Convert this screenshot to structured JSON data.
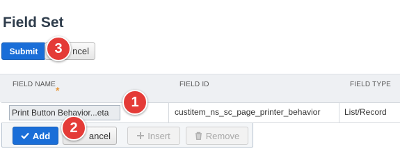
{
  "page": {
    "title": "Field Set"
  },
  "top_actions": {
    "submit_label": "Submit",
    "cancel_label": "Cancel",
    "cancel_visible": "ncel"
  },
  "table": {
    "headers": {
      "name": "FIELD NAME",
      "id": "FIELD ID",
      "type": "FIELD TYPE"
    },
    "required_marker": "*",
    "edit_row": {
      "name_value": "Print Button Behavior...eta",
      "field_id": "custitem_ns_sc_page_printer_behavior",
      "field_type": "List/Record"
    }
  },
  "row_actions": {
    "add_label": "Add",
    "cancel_label": "Cancel",
    "cancel_visible": "ancel",
    "insert_label": "Insert",
    "remove_label": "Remove"
  },
  "callouts": [
    "1",
    "2",
    "3"
  ],
  "colors": {
    "primary": "#1a6ed8",
    "callout": "#e43b37",
    "title": "#2f3d4c",
    "required": "#e8983a"
  },
  "icons": {
    "add": "check-icon",
    "insert": "plus-icon",
    "remove": "trash-icon"
  }
}
